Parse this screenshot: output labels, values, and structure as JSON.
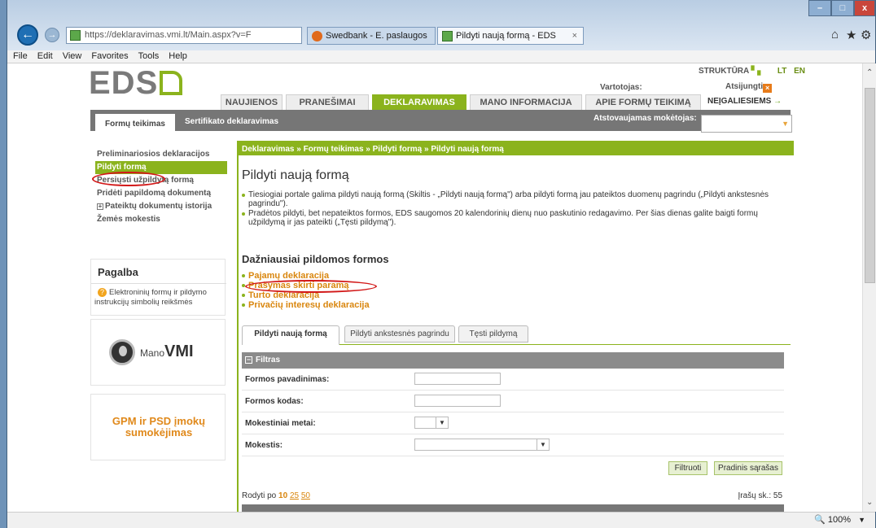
{
  "browser": {
    "address": "https://deklaravimas.vmi.lt/Main.aspx?v=F",
    "tabs": [
      {
        "label": "Swedbank - E. paslaugos",
        "active": false
      },
      {
        "label": "Pildyti naują formą - EDS",
        "active": true
      }
    ],
    "menu": [
      "File",
      "Edit",
      "View",
      "Favorites",
      "Tools",
      "Help"
    ],
    "zoom": "100%"
  },
  "header": {
    "logo": "EDS",
    "struktura": "STRUKTŪRA",
    "langs": [
      "LT",
      "EN"
    ],
    "vartotojas_label": "Vartotojas:",
    "atsijungti": "Atsijungti",
    "nav": [
      "NAUJIENOS",
      "PRANEŠIMAI",
      "DEKLARAVIMAS",
      "MANO INFORMACIJA",
      "APIE FORMŲ TEIKIMĄ"
    ],
    "neigaliesiems": "NEĮGALIESIEMS",
    "subtabs": [
      "Formų teikimas",
      "Sertifikato deklaravimas"
    ],
    "atstovaujamas": "Atstovaujamas mokėtojas:"
  },
  "sidebar": {
    "items": [
      "Preliminariosios deklaracijos",
      "Pildyti formą",
      "Persiųsti užpildytą formą",
      "Pridėti papildomą dokumentą",
      "Pateiktų dokumentų istorija",
      "Žemės mokestis"
    ],
    "pagalba_title": "Pagalba",
    "pagalba_text": "Elektroninių formų ir pildymo instrukcijų simbolių reikšmės",
    "manovmi_prefix": "Mano",
    "manovmi_brand": "VMI",
    "gpm": "GPM ir PSD įmokų sumokėjimas"
  },
  "content": {
    "breadcrumb": "Deklaravimas » Formų teikimas » Pildyti formą » Pildyti naują formą",
    "title": "Pildyti naują formą",
    "bullets": [
      "Tiesiogiai portale galima pildyti naują formą (Skiltis - „Pildyti naują formą\") arba pildyti formą jau pateiktos duomenų pagrindu („Pildyti ankstesnės pagrindu\").",
      "Pradėtos pildyti, bet nepateiktos formos, EDS saugomos 20 kalendorinių dienų nuo paskutinio redagavimo. Per šias dienas galite baigti formų užpildymą ir jas pateikti („Tęsti pildymą\")."
    ],
    "frequent_title": "Dažniausiai pildomos formos",
    "frequent": [
      "Pajamų deklaracija",
      "Prašymas skirti paramą",
      "Turto deklaracija",
      "Privačių interesų deklaracija"
    ],
    "tabs": [
      "Pildyti naują formą",
      "Pildyti ankstesnės pagrindu",
      "Tęsti pildymą"
    ],
    "filter_title": "Filtras",
    "fields": [
      {
        "label": "Formos pavadinimas:"
      },
      {
        "label": "Formos kodas:"
      },
      {
        "label": "Mokestiniai metai:"
      },
      {
        "label": "Mokestis:"
      }
    ],
    "btn_filter": "Filtruoti",
    "btn_reset": "Pradinis sąrašas",
    "rodyti_label": "Rodyti po",
    "rodyti_options": [
      "10",
      "25",
      "50"
    ],
    "irasu": "Įrašų sk.: 55"
  }
}
